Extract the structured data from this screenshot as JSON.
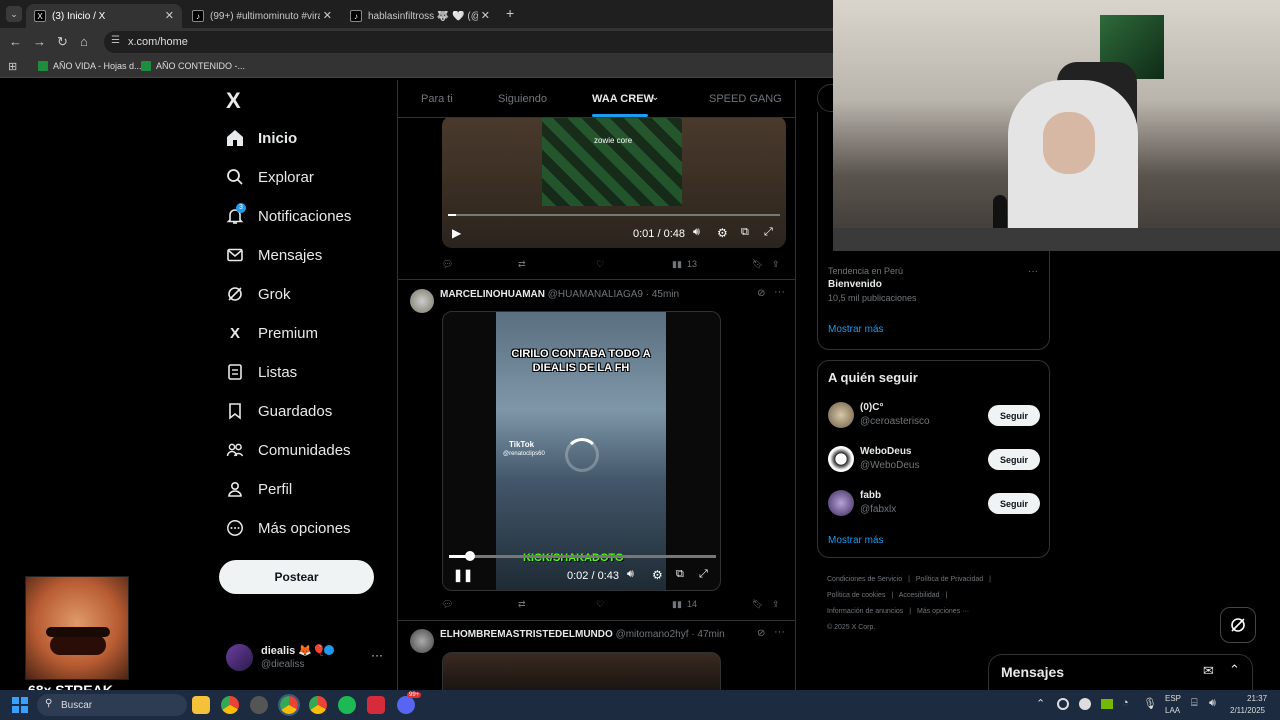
{
  "browser": {
    "tabs": [
      {
        "label": "(3) Inicio / X",
        "active": true
      },
      {
        "label": "(99+) #ultimominuto #vira #din"
      },
      {
        "label": "hablasinfiltross 🐺 🤍 (@hablas"
      }
    ],
    "new_tab": "+",
    "url": "x.com/home",
    "bookmarks": [
      "AÑO VIDA - Hojas d...",
      "AÑO CONTENIDO -..."
    ]
  },
  "sidebar": {
    "logo": "X",
    "items": [
      {
        "label": "Inicio",
        "icon": "home-icon"
      },
      {
        "label": "Explorar",
        "icon": "search-icon"
      },
      {
        "label": "Notificaciones",
        "icon": "bell-icon",
        "badge": "3"
      },
      {
        "label": "Mensajes",
        "icon": "mail-icon"
      },
      {
        "label": "Grok",
        "icon": "grok-icon"
      },
      {
        "label": "Premium",
        "icon": "x-icon"
      },
      {
        "label": "Listas",
        "icon": "list-icon"
      },
      {
        "label": "Guardados",
        "icon": "bookmark-icon"
      },
      {
        "label": "Comunidades",
        "icon": "communities-icon"
      },
      {
        "label": "Perfil",
        "icon": "person-icon"
      },
      {
        "label": "Más opciones",
        "icon": "more-circle-icon"
      }
    ],
    "post_label": "Postear",
    "account": {
      "name": "diealis 🦊🎈",
      "handle": "@diealiss"
    }
  },
  "feed": {
    "tabs": [
      "Para ti",
      "Siguiendo",
      "WAA CREW",
      "SPEED GANG"
    ],
    "tweet1": {
      "video_caption": "zowie core",
      "time": "0:01 / 0:48",
      "views": "13"
    },
    "tweet2": {
      "name": "MARCELINOHUAMAN",
      "handle": "@HUAMANALIAGA9",
      "age": "· 45min",
      "video_title": "CIRILO CONTABA TODO A DIEALIS DE LA FH",
      "tiktok": "TikTok",
      "tiktok_user": "@renatoclips60",
      "watermark": "KICK/SHAKADOTO",
      "time": "0:02 / 0:43",
      "views": "14"
    },
    "tweet3": {
      "name": "ELHOMBREMASTRISTEDELMUNDO",
      "handle": "@mitomano2hyf",
      "age": "· 47min"
    }
  },
  "right": {
    "trend": {
      "label": "Tendencia en Perú",
      "title": "Bienvenido",
      "count": "10,5 mil publicaciones"
    },
    "show_more": "Mostrar más",
    "who_title": "A quién seguir",
    "who": [
      {
        "name": "(0)C°",
        "handle": "@ceroasterisco"
      },
      {
        "name": "WeboDeus",
        "handle": "@WeboDeus"
      },
      {
        "name": "fabb",
        "handle": "@fabxlx"
      }
    ],
    "follow_label": "Seguir",
    "show_more2": "Mostrar más",
    "footer": [
      "Condiciones de Servicio",
      "|",
      "Política de Privacidad",
      "|",
      "Política de cookies",
      "|",
      "Accesibilidad",
      "|",
      "Información de anuncios",
      "|",
      "Más opciones ···",
      "© 2025 X Corp."
    ],
    "messages_title": "Mensajes"
  },
  "overlay": {
    "streak": "68x STREAK"
  },
  "taskbar": {
    "search": "Buscar",
    "lang": "ESP",
    "lang2": "LAA",
    "time": "21:37",
    "date": "2/11/2025",
    "badge": "99+"
  }
}
